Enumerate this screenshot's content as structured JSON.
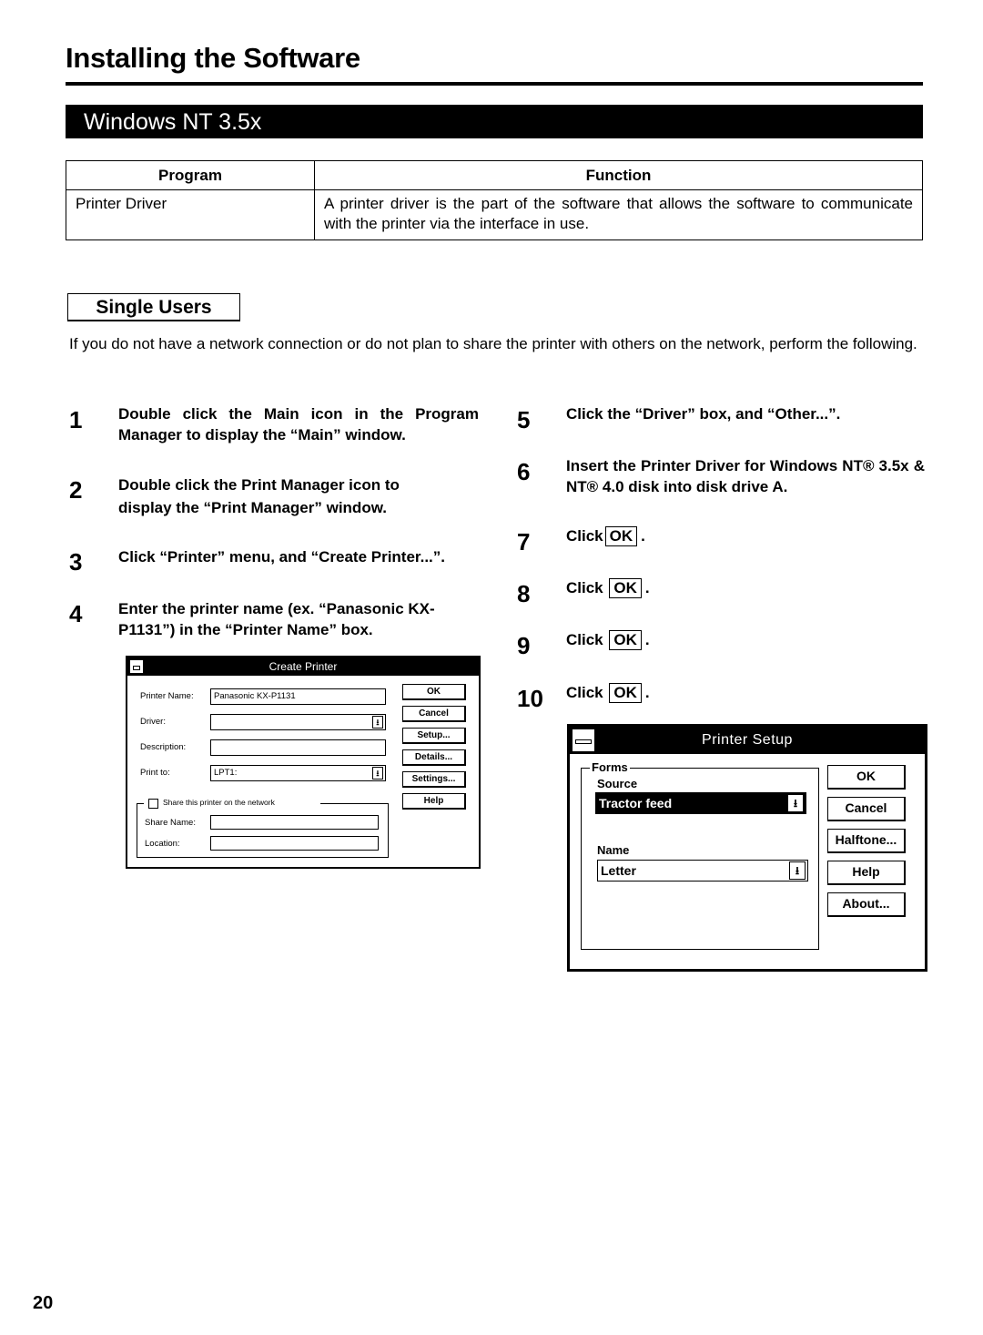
{
  "page": {
    "title": "Installing the Software",
    "banner": "Windows NT 3.5x",
    "page_number": "20"
  },
  "program_table": {
    "headers": [
      "Program",
      "Function"
    ],
    "rows": [
      {
        "program": "Printer Driver",
        "function": "A printer driver is the part of the software that allows the software to communicate with the printer via the interface in use."
      }
    ]
  },
  "section": {
    "label": "Single Users",
    "intro": "If you do not have a network connection or do not plan to share the printer with others on the network, perform the following."
  },
  "steps": [
    {
      "num": "1",
      "text": "Double click the Main icon in the Program Manager to display the “Main” window."
    },
    {
      "num": "2",
      "text": "Double click the Print Manager icon to display the “Print Manager” window."
    },
    {
      "num": "3",
      "text": "Click “Printer” menu, and “Create Printer...”."
    },
    {
      "num": "4",
      "text": "Enter the printer name (ex. “Panasonic KX-P1131”) in the “Printer Name” box."
    },
    {
      "num": "5",
      "text": "Click the “Driver” box, and “Other...”."
    },
    {
      "num": "6",
      "text": "Insert the Printer Driver for Windows NT® 3.5x & NT® 4.0 disk into disk drive A."
    },
    {
      "num": "7",
      "prefix": "Click",
      "button": "OK",
      "suffix": "."
    },
    {
      "num": "8",
      "prefix": "Click",
      "button": "OK",
      "suffix": "."
    },
    {
      "num": "9",
      "prefix": "Click",
      "button": "OK",
      "suffix": "."
    },
    {
      "num": "10",
      "prefix": "Click",
      "button": "OK",
      "suffix": "."
    }
  ],
  "create_printer_dialog": {
    "title": "Create Printer",
    "fields": {
      "printer_name": {
        "label": "Printer Name:",
        "value": "Panasonic KX-P1131"
      },
      "driver": {
        "label": "Driver:",
        "value": ""
      },
      "description": {
        "label": "Description:",
        "value": ""
      },
      "print_to": {
        "label": "Print to:",
        "value": "LPT1:"
      },
      "share_name": {
        "label": "Share Name:",
        "value": ""
      },
      "location": {
        "label": "Location:",
        "value": ""
      }
    },
    "share_checkbox": {
      "label": "Share this printer on the network",
      "checked": false
    },
    "buttons": [
      "OK",
      "Cancel",
      "Setup...",
      "Details...",
      "Settings...",
      "Help"
    ],
    "dropdown_icon": "down-arrow-icon"
  },
  "printer_setup_dialog": {
    "title": "Printer Setup",
    "group_label": "Forms",
    "source": {
      "label": "Source",
      "value": "Tractor feed"
    },
    "name": {
      "label": "Name",
      "value": "Letter"
    },
    "buttons": [
      "OK",
      "Cancel",
      "Halftone...",
      "Help",
      "About..."
    ],
    "dropdown_icon": "down-arrow-icon"
  }
}
